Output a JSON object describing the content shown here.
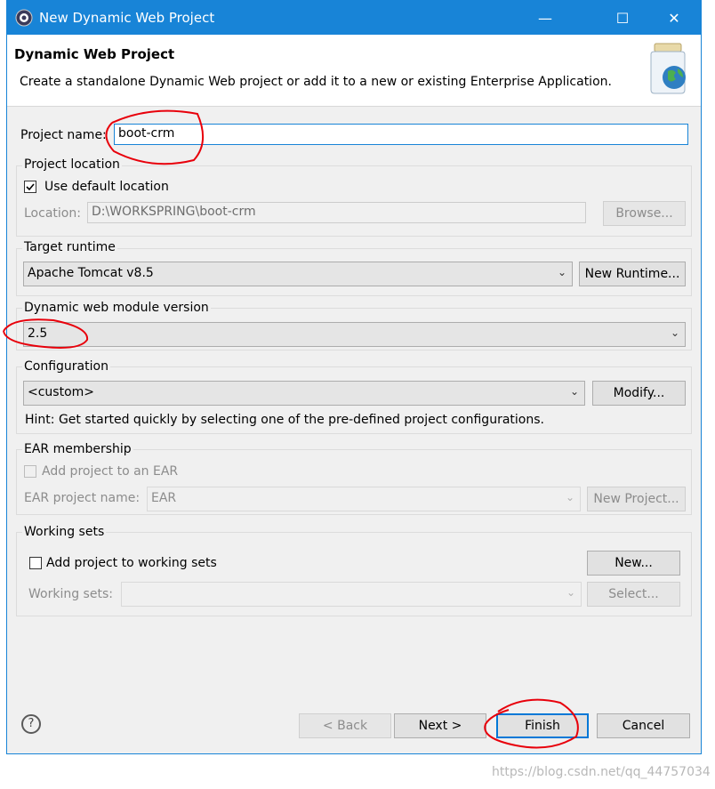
{
  "window": {
    "title": "New Dynamic Web Project",
    "minimize": "—",
    "maximize": "☐",
    "close": "✕"
  },
  "header": {
    "title": "Dynamic Web Project",
    "description": "Create a standalone Dynamic Web project or add it to a new or existing Enterprise Application."
  },
  "project_name": {
    "label": "Project name:",
    "value": "boot-crm"
  },
  "project_location": {
    "group_label": "Project location",
    "use_default_label": "Use default location",
    "use_default_checked": true,
    "location_label": "Location:",
    "location_value": "D:\\WORKSPRING\\boot-crm",
    "browse_label": "Browse..."
  },
  "target_runtime": {
    "group_label": "Target runtime",
    "selected": "Apache Tomcat v8.5",
    "new_runtime_label": "New Runtime..."
  },
  "module_version": {
    "group_label": "Dynamic web module version",
    "selected": "2.5"
  },
  "configuration": {
    "group_label": "Configuration",
    "selected": "<custom>",
    "modify_label": "Modify...",
    "hint": "Hint: Get started quickly by selecting one of the pre-defined project configurations."
  },
  "ear": {
    "group_label": "EAR membership",
    "add_label": "Add project to an EAR",
    "add_checked": false,
    "project_name_label": "EAR project name:",
    "project_name_value": "EAR",
    "new_project_label": "New Project..."
  },
  "working_sets": {
    "group_label": "Working sets",
    "add_label": "Add project to working sets",
    "add_checked": false,
    "new_label": "New...",
    "sets_label": "Working sets:",
    "select_label": "Select..."
  },
  "footer": {
    "help": "?",
    "back_label": "< Back",
    "next_label": "Next >",
    "finish_label": "Finish",
    "cancel_label": "Cancel"
  },
  "watermark": "https://blog.csdn.net/qq_44757034",
  "colors": {
    "accent": "#1884d7",
    "annotation": "#e8000b"
  }
}
